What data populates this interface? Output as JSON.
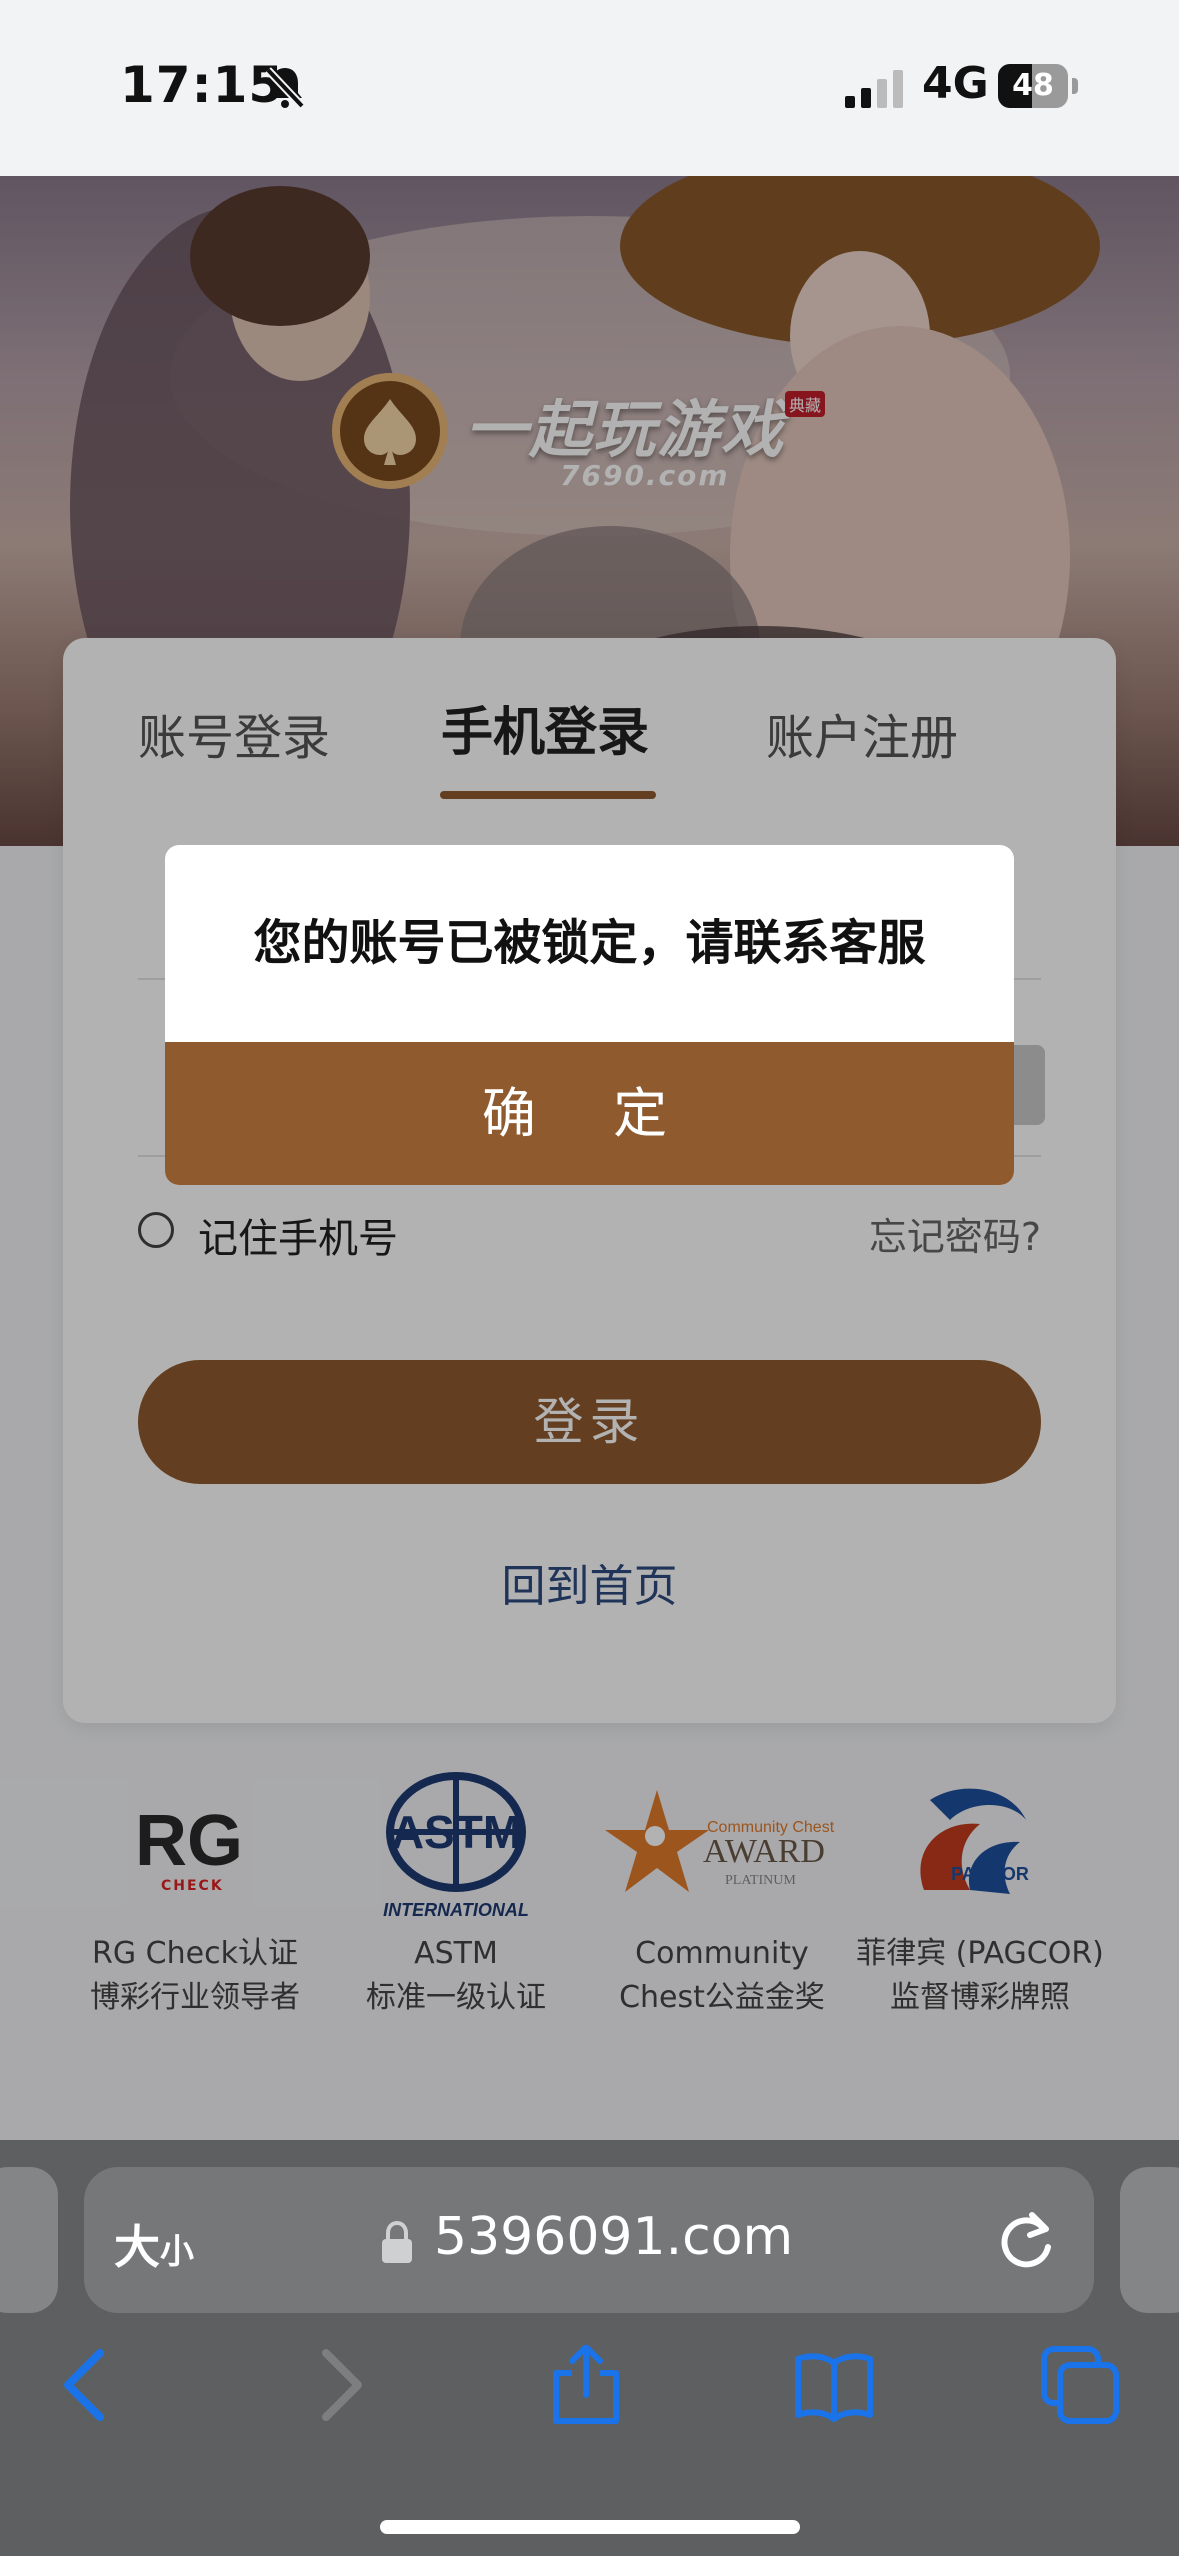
{
  "status_bar": {
    "time": "17:15",
    "network": "4G",
    "battery": "48",
    "battery_fraction": 0.48
  },
  "banner": {
    "brand_name": "一起玩游戏",
    "brand_domain": "7690.com",
    "brand_badge": "典藏"
  },
  "login_card": {
    "tabs": [
      {
        "label": "账号登录",
        "active": false
      },
      {
        "label": "手机登录",
        "active": true
      },
      {
        "label": "账户注册",
        "active": false
      }
    ],
    "remember_label": "记住手机号",
    "forgot_label": "忘记密码?",
    "login_button": "登录",
    "home_link": "回到首页"
  },
  "certifications": [
    {
      "logo": "RG",
      "logo_sub": "CHECK",
      "line1": "RG Check认证",
      "line2": "博彩行业领导者"
    },
    {
      "logo": "ASTM",
      "logo_sub": "INTERNATIONAL",
      "line1": "ASTM",
      "line2": "标准一级认证"
    },
    {
      "logo": "Community Chest AWARD PLATINUM",
      "line1": "Community",
      "line2": "Chest公益金奖"
    },
    {
      "logo": "PAGCOR",
      "line1": "菲律宾 (PAGCOR)",
      "line2": "监督博彩牌照"
    }
  ],
  "dialog": {
    "message": "您的账号已被锁定，请联系客服",
    "confirm_label": "确 定"
  },
  "browser": {
    "text_size_big": "大",
    "text_size_small": "小",
    "url": "5396091.com",
    "icons": [
      "back-icon",
      "forward-icon",
      "share-icon",
      "bookmarks-icon",
      "tabs-icon"
    ]
  },
  "colors": {
    "accent": "#8e5a2e",
    "link": "#2d4b7e",
    "browser_icon": "#1a73e8"
  }
}
